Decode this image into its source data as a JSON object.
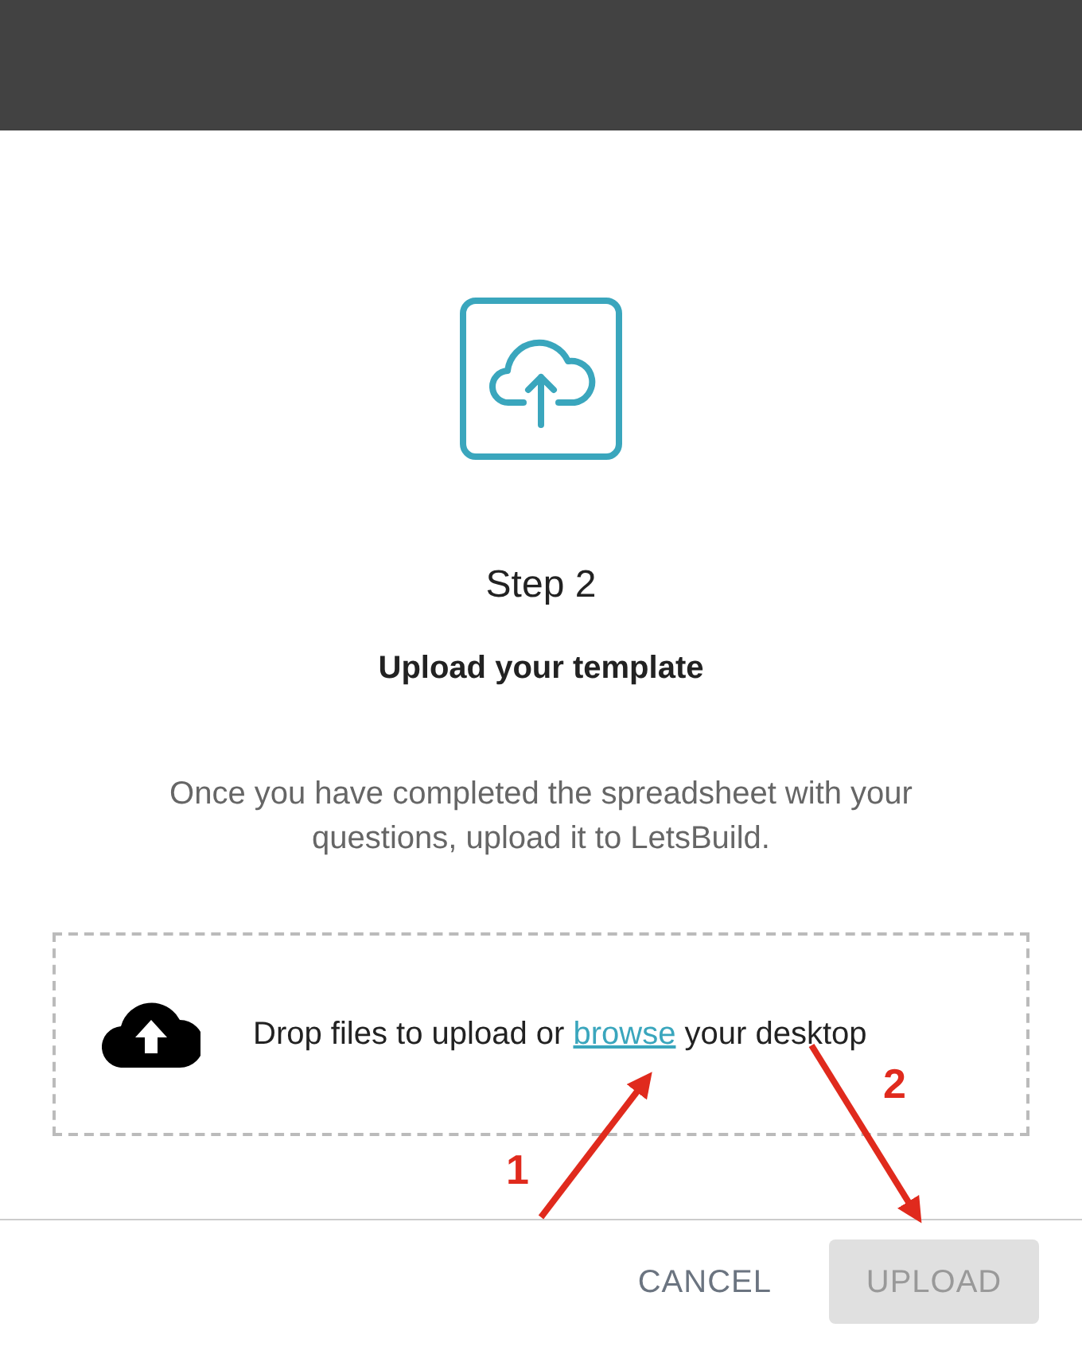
{
  "step": "Step 2",
  "title": "Upload your template",
  "description": "Once you have completed the spreadsheet with your questions, upload it to LetsBuild.",
  "dropzone": {
    "text_before": "Drop files to upload or",
    "link": "browse",
    "text_after": "your desktop"
  },
  "buttons": [
    {
      "label": "CANCEL",
      "kind": "text",
      "disabled": false
    },
    {
      "label": "UPLOAD",
      "kind": "filled",
      "disabled": true
    }
  ],
  "annotations": [
    {
      "label": "1"
    },
    {
      "label": "2"
    }
  ]
}
